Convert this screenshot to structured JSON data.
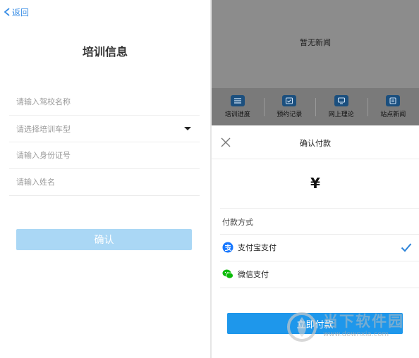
{
  "left_screen": {
    "back_label": "返回",
    "title": "培训信息",
    "fields": {
      "school_placeholder": "请输入驾校名称",
      "vehicle_select_text": "请选择培训车型",
      "id_placeholder": "请输入身份证号",
      "name_placeholder": "请输入姓名"
    },
    "confirm_label": "确认"
  },
  "right_screen": {
    "news_empty_text": "暂无新闻",
    "quick_items": [
      {
        "label": "培训进度",
        "icon": "list-icon"
      },
      {
        "label": "预约记录",
        "icon": "calendar-check-icon"
      },
      {
        "label": "网上理论",
        "icon": "monitor-icon"
      },
      {
        "label": "站点新闻",
        "icon": "news-icon"
      }
    ],
    "payment": {
      "title": "确认付款",
      "currency_symbol": "¥",
      "method_label": "付款方式",
      "methods": [
        {
          "label": "支付宝支付",
          "icon": "alipay-icon",
          "selected": true
        },
        {
          "label": "微信支付",
          "icon": "wechat-icon",
          "selected": false
        }
      ],
      "pay_button_label": "立即付款"
    }
  },
  "watermark": {
    "text": "当下软件园",
    "url": "www.downxia.com"
  },
  "colors": {
    "accent": "#3a8ee6",
    "confirm_disabled": "#aad7f5",
    "pay_button": "#1e97eb",
    "alipay": "#1677ff",
    "wechat": "#09bb07"
  }
}
